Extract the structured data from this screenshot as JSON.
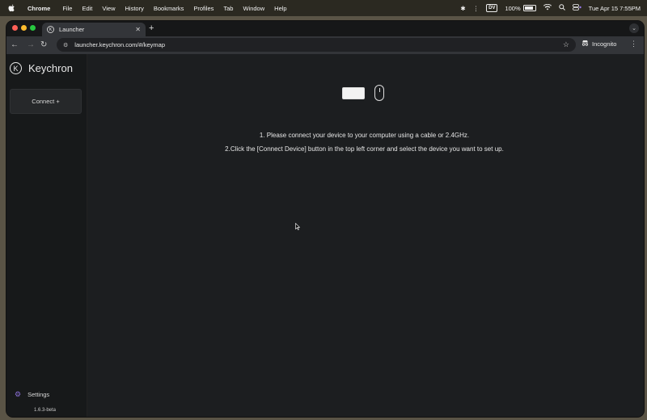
{
  "menubar": {
    "app": "Chrome",
    "items": [
      "File",
      "Edit",
      "View",
      "History",
      "Bookmarks",
      "Profiles",
      "Tab",
      "Window",
      "Help"
    ],
    "input_badge": "DV",
    "battery": "100%",
    "datetime": "Tue Apr 15  7:55PM"
  },
  "browser": {
    "tab_title": "Launcher",
    "url": "launcher.keychron.com/#/keymap",
    "incognito_label": "Incognito"
  },
  "app": {
    "brand": "Keychron",
    "connect_label": "Connect +",
    "settings_label": "Settings",
    "version": "1.6.3-beta",
    "instruction_1": "1. Please connect your device to your computer using a cable or 2.4GHz.",
    "instruction_2": "2.Click the [Connect Device] button in the top left corner and select the device you want to set up."
  },
  "colors": {
    "accent": "#8a6fd6",
    "background": "#1c1e20",
    "sidebar": "#17191a"
  }
}
